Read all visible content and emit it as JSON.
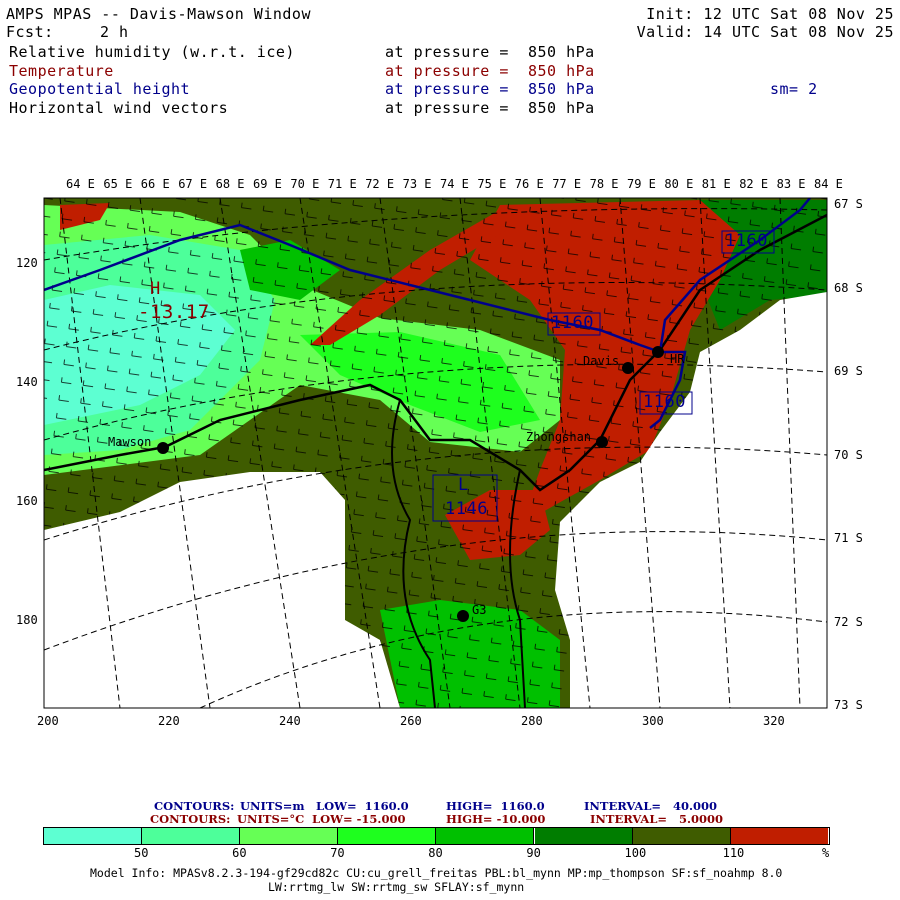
{
  "header": {
    "title": "AMPS MPAS -- Davis-Mawson Window",
    "fcst_label": "Fcst:",
    "fcst_value": "2 h",
    "init": "Init: 12 UTC Sat 08 Nov 25",
    "valid": "Valid: 14 UTC Sat 08 Nov 25"
  },
  "fields": [
    {
      "name": "Relative humidity (w.r.t. ice)",
      "level": "at pressure =  850 hPa",
      "color": "#000000"
    },
    {
      "name": "Temperature",
      "level": "at pressure =  850 hPa",
      "color": "#8b0000"
    },
    {
      "name": "Geopotential height",
      "level": "at pressure =  850 hPa",
      "extra": "sm= 2",
      "color": "#00008b"
    },
    {
      "name": "Horizontal wind vectors",
      "level": "at pressure =  850 hPa",
      "color": "#000000"
    }
  ],
  "map": {
    "top_lon_labels": [
      "64 E",
      "65 E",
      "66 E",
      "67 E",
      "68 E",
      "69 E",
      "70 E",
      "71 E",
      "72 E",
      "73 E",
      "74 E",
      "75 E",
      "76 E",
      "77 E",
      "78 E",
      "79 E",
      "80 E",
      "81 E",
      "82 E",
      "83 E",
      "84 E"
    ],
    "right_lat_labels": [
      "67 S",
      "68 S",
      "69 S",
      "70 S",
      "71 S",
      "72 S",
      "73 S"
    ],
    "left_y_ticks": [
      "120",
      "140",
      "160",
      "180"
    ],
    "bottom_x_ticks": [
      "200",
      "220",
      "240",
      "260",
      "280",
      "300",
      "320"
    ],
    "places": [
      "Mawson",
      "Davis",
      "Zhongshan",
      "HR",
      "G3"
    ],
    "high_label": "H",
    "high_value": "-13.17",
    "low_label": "L",
    "low_value": "1146",
    "height_labels": [
      "1160",
      "1160",
      "1160"
    ]
  },
  "contours": {
    "height": {
      "prefix": "CONTOURS:",
      "units": "UNITS=m",
      "low": "LOW=  1160.0",
      "high": "HIGH=  1160.0",
      "interval": "INTERVAL=   40.000",
      "color": "#00008b"
    },
    "temp": {
      "prefix": "CONTOURS:",
      "units": "UNITS=°C",
      "low": "LOW= -15.000",
      "high": "HIGH= -10.000",
      "interval": "INTERVAL=   5.0000",
      "color": "#8b0000"
    }
  },
  "colorbar": {
    "colors": [
      "#5dffd2",
      "#4dff9a",
      "#66ff55",
      "#1eff1e",
      "#00c000",
      "#007d00",
      "#3f5c00",
      "#c01e00"
    ],
    "labels": [
      "50",
      "60",
      "70",
      "80",
      "90",
      "100",
      "110"
    ],
    "unit": "%"
  },
  "model_info": {
    "line1": "Model Info: MPASv8.2.3-194-gf29cd82c CU:cu_grell_freitas PBL:bl_mynn MP:mp_thompson SF:sf_noahmp 8.0",
    "line2": "LW:rrtmg_lw SW:rrtmg_sw SFLAY:sf_mynn"
  }
}
